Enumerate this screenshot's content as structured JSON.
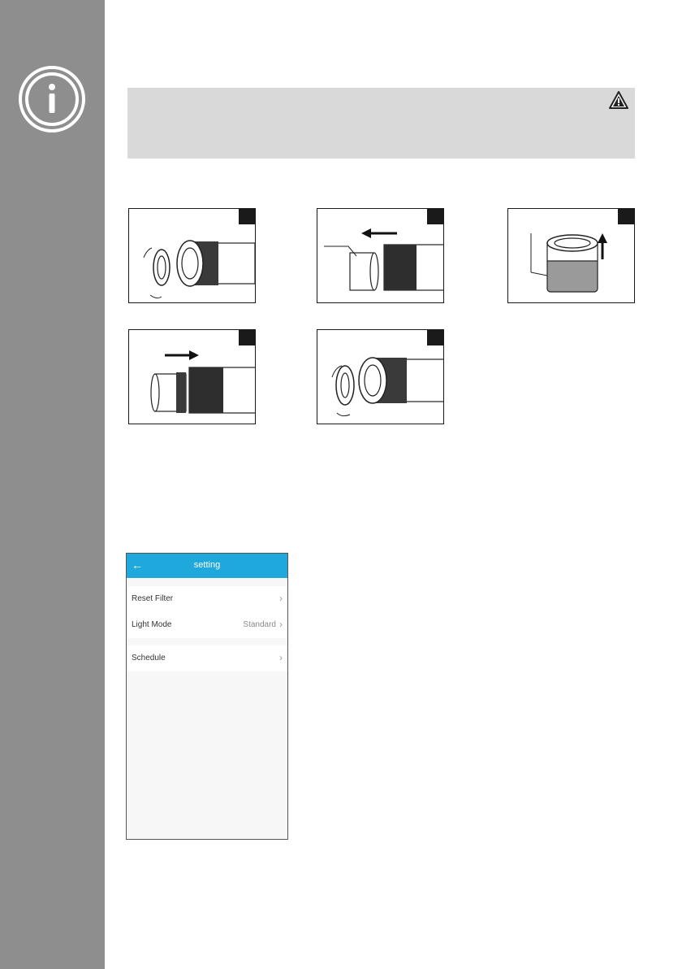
{
  "page": {
    "figure_numbers": [
      "",
      "",
      "",
      "",
      ""
    ]
  },
  "phone": {
    "header": {
      "back_icon": "←",
      "title": "setting"
    },
    "rows": [
      {
        "label": "Reset Filter",
        "value": "",
        "chevron": "›"
      },
      {
        "label": "Light Mode",
        "value": "Standard",
        "chevron": "›"
      },
      {
        "label": "Schedule",
        "value": "",
        "chevron": "›"
      }
    ]
  },
  "colors": {
    "sidebar": "#8e8e8e",
    "warning_box": "#d9d9d9",
    "app_header": "#1ea8dc"
  },
  "icons": {
    "sidebar": "info-circle-icon",
    "warning": "warning-triangle-icon"
  }
}
